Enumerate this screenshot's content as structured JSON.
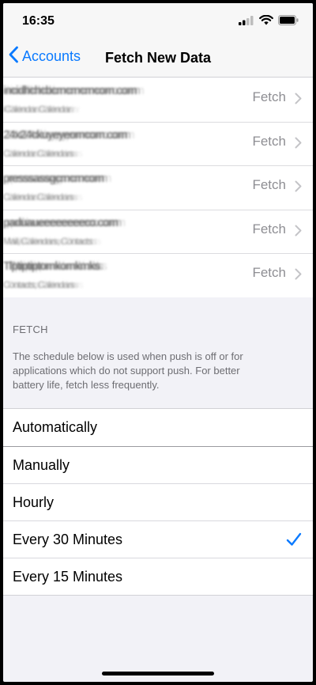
{
  "status": {
    "time": "16:35"
  },
  "nav": {
    "back_label": "Accounts",
    "title": "Fetch New Data"
  },
  "accounts": [
    {
      "name": "incidhchcbcmcmcmcom.com",
      "sub": "iCalendar Calendar",
      "value": "Fetch"
    },
    {
      "name": "24x24ckuyeyeomcom.com",
      "sub": "Calendar Calendars",
      "value": "Fetch"
    },
    {
      "name": "presssassgcmcmcom",
      "sub": "Calendar Calendars",
      "value": "Fetch"
    },
    {
      "name": "paduaueeeeeeeeco.com",
      "sub": "Mail, Calendars, Contacts",
      "value": "Fetch"
    },
    {
      "name": "Tlptiptiptomkomkmks",
      "sub": "Contacts, Calendars",
      "value": "Fetch"
    }
  ],
  "fetch_section": {
    "header": "FETCH",
    "description": "The schedule below is used when push is off or for applications which do not support push. For better battery life, fetch less frequently."
  },
  "options": [
    {
      "label": "Automatically",
      "selected": false
    },
    {
      "label": "Manually",
      "selected": false
    },
    {
      "label": "Hourly",
      "selected": false
    },
    {
      "label": "Every 30 Minutes",
      "selected": true
    },
    {
      "label": "Every 15 Minutes",
      "selected": false
    }
  ],
  "colors": {
    "accent": "#0a7aff",
    "background": "#f2f2f7"
  }
}
